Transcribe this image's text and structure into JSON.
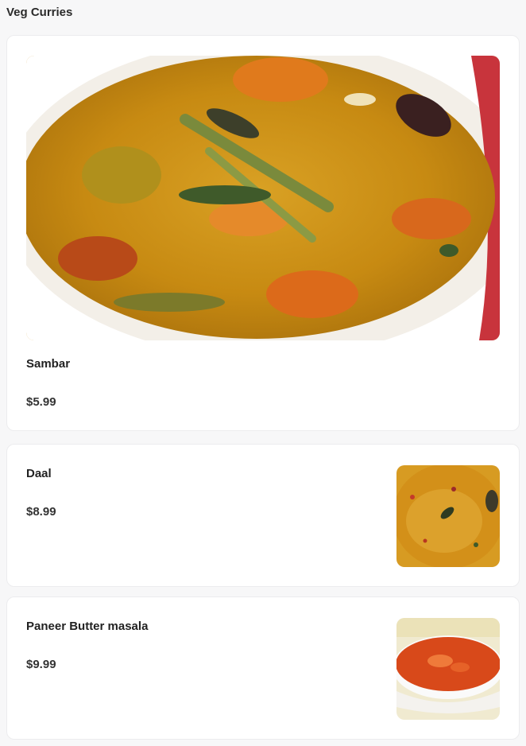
{
  "section": {
    "title": "Veg Curries"
  },
  "items": [
    {
      "name": "Sambar",
      "price": "$5.99",
      "image_icon": "sambar-image"
    },
    {
      "name": "Daal",
      "price": "$8.99",
      "image_icon": "daal-image"
    },
    {
      "name": "Paneer Butter masala",
      "price": "$9.99",
      "image_icon": "paneer-butter-masala-image"
    }
  ],
  "colors": {
    "background": "#f7f7f8",
    "card": "#ffffff",
    "card_border": "#ececee",
    "text": "#222222"
  }
}
